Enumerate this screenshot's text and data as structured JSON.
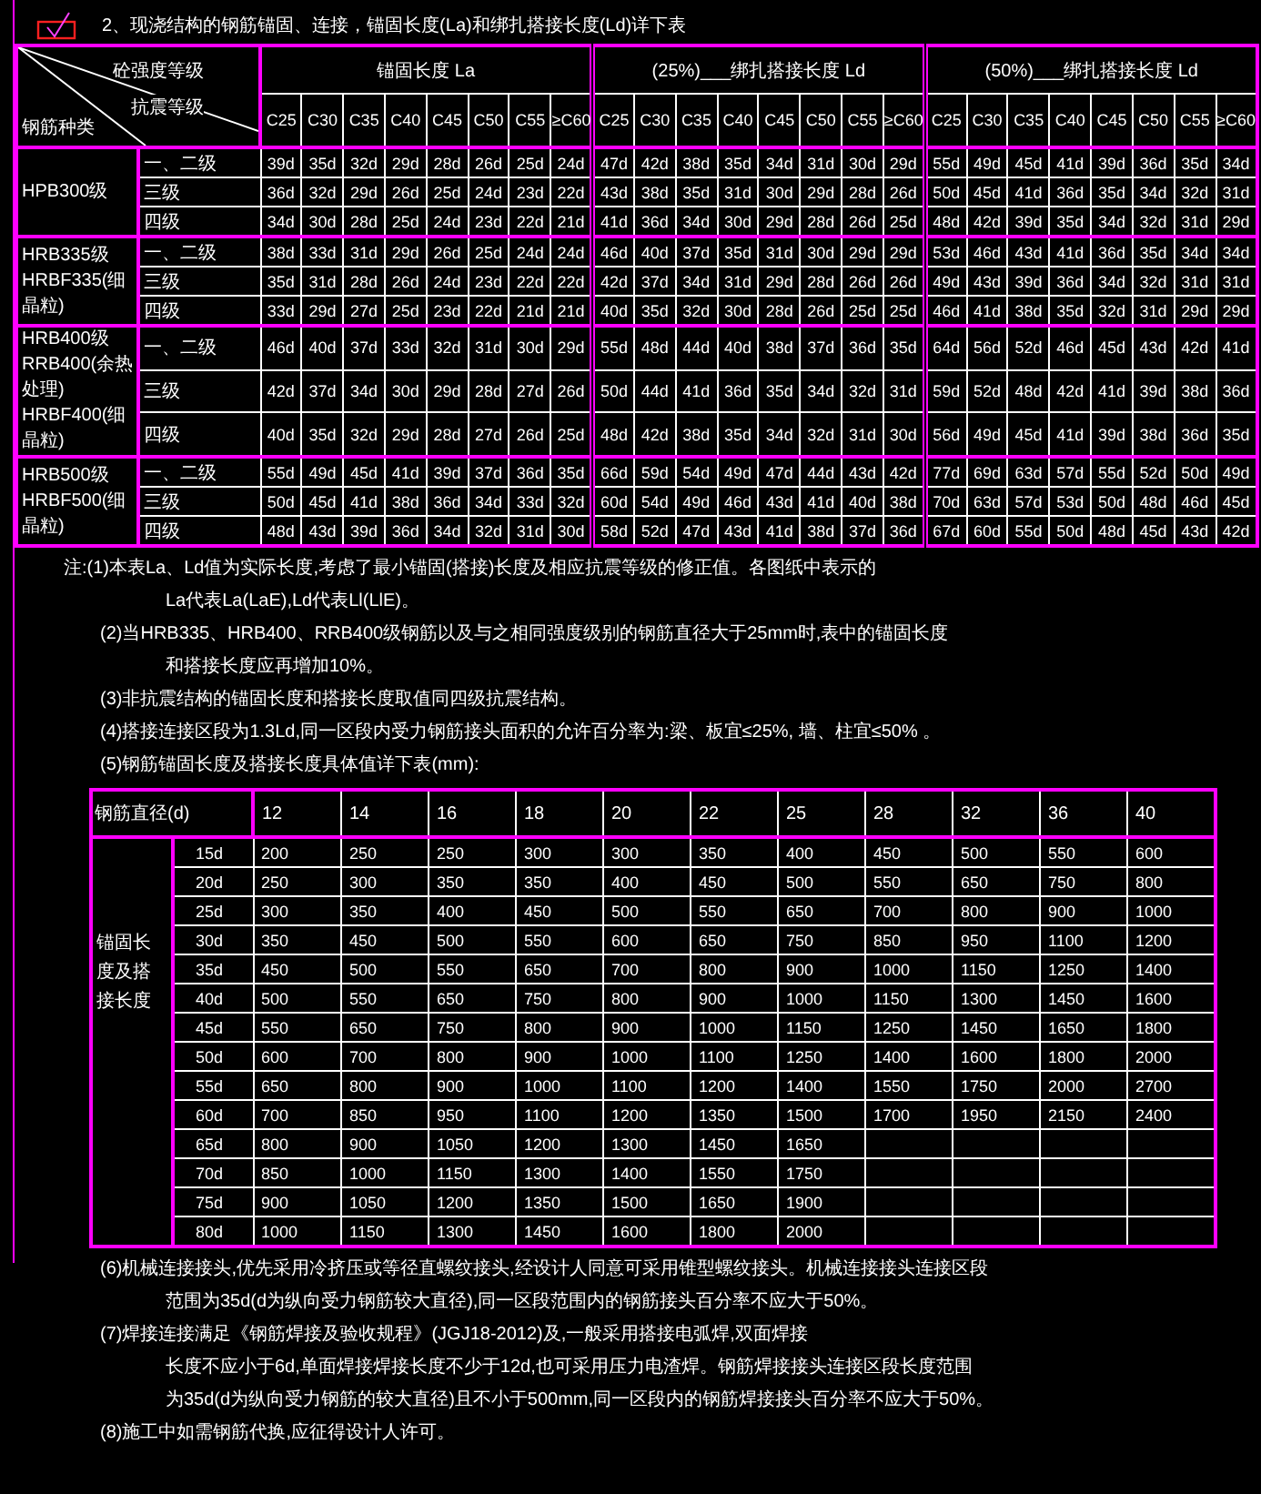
{
  "title_checkbox": {
    "checked": true
  },
  "title": "2、现浇结构的钢筋锚固、连接，锚固长度(La)和绑扎搭接长度(Ld)详下表",
  "anchor_table": {
    "corner": {
      "top": "砼强度等级",
      "middle": "抗震等级",
      "bottom": "钢筋种类"
    },
    "groups": [
      {
        "label": "锚固长度 La",
        "grades": [
          "C25",
          "C30",
          "C35",
          "C40",
          "C45",
          "C50",
          "C55",
          "≥C60"
        ]
      },
      {
        "label": "(25%)___绑扎搭接长度 Ld",
        "grades": [
          "C25",
          "C30",
          "C35",
          "C40",
          "C45",
          "C50",
          "C55",
          "≥C60"
        ]
      },
      {
        "label": "(50%)___绑扎搭接长度 Ld",
        "grades": [
          "C25",
          "C30",
          "C35",
          "C40",
          "C45",
          "C50",
          "C55",
          "≥C60"
        ]
      }
    ],
    "steel_types": [
      {
        "names": [
          "HPB300级"
        ],
        "rows": [
          {
            "level": "一、二级",
            "values": [
              "39d",
              "35d",
              "32d",
              "29d",
              "28d",
              "26d",
              "25d",
              "24d",
              "47d",
              "42d",
              "38d",
              "35d",
              "34d",
              "31d",
              "30d",
              "29d",
              "55d",
              "49d",
              "45d",
              "41d",
              "39d",
              "36d",
              "35d",
              "34d"
            ]
          },
          {
            "level": "三级",
            "values": [
              "36d",
              "32d",
              "29d",
              "26d",
              "25d",
              "24d",
              "23d",
              "22d",
              "43d",
              "38d",
              "35d",
              "31d",
              "30d",
              "29d",
              "28d",
              "26d",
              "50d",
              "45d",
              "41d",
              "36d",
              "35d",
              "34d",
              "32d",
              "31d"
            ]
          },
          {
            "level": "四级",
            "values": [
              "34d",
              "30d",
              "28d",
              "25d",
              "24d",
              "23d",
              "22d",
              "21d",
              "41d",
              "36d",
              "34d",
              "30d",
              "29d",
              "28d",
              "26d",
              "25d",
              "48d",
              "42d",
              "39d",
              "35d",
              "34d",
              "32d",
              "31d",
              "29d"
            ]
          }
        ]
      },
      {
        "names": [
          "HRB335级",
          "HRBF335(细晶粒)"
        ],
        "rows": [
          {
            "level": "一、二级",
            "values": [
              "38d",
              "33d",
              "31d",
              "29d",
              "26d",
              "25d",
              "24d",
              "24d",
              "46d",
              "40d",
              "37d",
              "35d",
              "31d",
              "30d",
              "29d",
              "29d",
              "53d",
              "46d",
              "43d",
              "41d",
              "36d",
              "35d",
              "34d",
              "34d"
            ]
          },
          {
            "level": "三级",
            "values": [
              "35d",
              "31d",
              "28d",
              "26d",
              "24d",
              "23d",
              "22d",
              "22d",
              "42d",
              "37d",
              "34d",
              "31d",
              "29d",
              "28d",
              "26d",
              "26d",
              "49d",
              "43d",
              "39d",
              "36d",
              "34d",
              "32d",
              "31d",
              "31d"
            ]
          },
          {
            "level": "四级",
            "values": [
              "33d",
              "29d",
              "27d",
              "25d",
              "23d",
              "22d",
              "21d",
              "21d",
              "40d",
              "35d",
              "32d",
              "30d",
              "28d",
              "26d",
              "25d",
              "25d",
              "46d",
              "41d",
              "38d",
              "35d",
              "32d",
              "31d",
              "29d",
              "29d"
            ]
          }
        ]
      },
      {
        "names": [
          "HRB400级",
          "RRB400(余热处理)",
          "HRBF400(细晶粒)"
        ],
        "rows": [
          {
            "level": "一、二级",
            "values": [
              "46d",
              "40d",
              "37d",
              "33d",
              "32d",
              "31d",
              "30d",
              "29d",
              "55d",
              "48d",
              "44d",
              "40d",
              "38d",
              "37d",
              "36d",
              "35d",
              "64d",
              "56d",
              "52d",
              "46d",
              "45d",
              "43d",
              "42d",
              "41d"
            ]
          },
          {
            "level": "三级",
            "values": [
              "42d",
              "37d",
              "34d",
              "30d",
              "29d",
              "28d",
              "27d",
              "26d",
              "50d",
              "44d",
              "41d",
              "36d",
              "35d",
              "34d",
              "32d",
              "31d",
              "59d",
              "52d",
              "48d",
              "42d",
              "41d",
              "39d",
              "38d",
              "36d"
            ]
          },
          {
            "level": "四级",
            "values": [
              "40d",
              "35d",
              "32d",
              "29d",
              "28d",
              "27d",
              "26d",
              "25d",
              "48d",
              "42d",
              "38d",
              "35d",
              "34d",
              "32d",
              "31d",
              "30d",
              "56d",
              "49d",
              "45d",
              "41d",
              "39d",
              "38d",
              "36d",
              "35d"
            ]
          }
        ]
      },
      {
        "names": [
          "HRB500级",
          "HRBF500(细晶粒)"
        ],
        "rows": [
          {
            "level": "一、二级",
            "values": [
              "55d",
              "49d",
              "45d",
              "41d",
              "39d",
              "37d",
              "36d",
              "35d",
              "66d",
              "59d",
              "54d",
              "49d",
              "47d",
              "44d",
              "43d",
              "42d",
              "77d",
              "69d",
              "63d",
              "57d",
              "55d",
              "52d",
              "50d",
              "49d"
            ]
          },
          {
            "level": "三级",
            "values": [
              "50d",
              "45d",
              "41d",
              "38d",
              "36d",
              "34d",
              "33d",
              "32d",
              "60d",
              "54d",
              "49d",
              "46d",
              "43d",
              "41d",
              "40d",
              "38d",
              "70d",
              "63d",
              "57d",
              "53d",
              "50d",
              "48d",
              "46d",
              "45d"
            ]
          },
          {
            "level": "四级",
            "values": [
              "48d",
              "43d",
              "39d",
              "36d",
              "34d",
              "32d",
              "31d",
              "30d",
              "58d",
              "52d",
              "47d",
              "43d",
              "41d",
              "38d",
              "37d",
              "36d",
              "67d",
              "60d",
              "55d",
              "50d",
              "48d",
              "45d",
              "43d",
              "42d"
            ]
          }
        ]
      }
    ]
  },
  "notes": [
    {
      "kind": "head",
      "text": "注:(1)本表La、Ld值为实际长度,考虑了最小锚固(搭接)长度及相应抗震等级的修正值。各图纸中表示的"
    },
    {
      "kind": "cont",
      "text": "La代表La(LaE),Ld代表Ll(LlE)。"
    },
    {
      "kind": "item",
      "text": "(2)当HRB335、HRB400、RRB400级钢筋以及与之相同强度级别的钢筋直径大于25mm时,表中的锚固长度"
    },
    {
      "kind": "cont",
      "text": "和搭接长度应再增加10%。"
    },
    {
      "kind": "item",
      "text": "(3)非抗震结构的锚固长度和搭接长度取值同四级抗震结构。"
    },
    {
      "kind": "item",
      "text": "(4)搭接连接区段为1.3Ld,同一区段内受力钢筋接头面积的允许百分率为:梁、板宜≤25%, 墙、柱宜≤50% 。"
    },
    {
      "kind": "item",
      "text": "(5)钢筋锚固长度及搭接长度具体值详下表(mm):"
    }
  ],
  "length_table": {
    "header": "钢筋直径(d)",
    "diameters": [
      "12",
      "14",
      "16",
      "18",
      "20",
      "22",
      "25",
      "28",
      "32",
      "36",
      "40"
    ],
    "side_label": "锚固长度及搭接长度",
    "rows": [
      {
        "multiple": "15d",
        "values": [
          "200",
          "250",
          "250",
          "300",
          "300",
          "350",
          "400",
          "450",
          "500",
          "550",
          "600"
        ]
      },
      {
        "multiple": "20d",
        "values": [
          "250",
          "300",
          "350",
          "350",
          "400",
          "450",
          "500",
          "550",
          "650",
          "750",
          "800"
        ]
      },
      {
        "multiple": "25d",
        "values": [
          "300",
          "350",
          "400",
          "450",
          "500",
          "550",
          "650",
          "700",
          "800",
          "900",
          "1000"
        ]
      },
      {
        "multiple": "30d",
        "values": [
          "350",
          "450",
          "500",
          "550",
          "600",
          "650",
          "750",
          "850",
          "950",
          "1100",
          "1200"
        ]
      },
      {
        "multiple": "35d",
        "values": [
          "450",
          "500",
          "550",
          "650",
          "700",
          "800",
          "900",
          "1000",
          "1150",
          "1250",
          "1400"
        ]
      },
      {
        "multiple": "40d",
        "values": [
          "500",
          "550",
          "650",
          "750",
          "800",
          "900",
          "1000",
          "1150",
          "1300",
          "1450",
          "1600"
        ]
      },
      {
        "multiple": "45d",
        "values": [
          "550",
          "650",
          "750",
          "800",
          "900",
          "1000",
          "1150",
          "1250",
          "1450",
          "1650",
          "1800"
        ]
      },
      {
        "multiple": "50d",
        "values": [
          "600",
          "700",
          "800",
          "900",
          "1000",
          "1100",
          "1250",
          "1400",
          "1600",
          "1800",
          "2000"
        ]
      },
      {
        "multiple": "55d",
        "values": [
          "650",
          "800",
          "900",
          "1000",
          "1100",
          "1200",
          "1400",
          "1550",
          "1750",
          "2000",
          "2700"
        ]
      },
      {
        "multiple": "60d",
        "values": [
          "700",
          "850",
          "950",
          "1100",
          "1200",
          "1350",
          "1500",
          "1700",
          "1950",
          "2150",
          "2400"
        ]
      },
      {
        "multiple": "65d",
        "values": [
          "800",
          "900",
          "1050",
          "1200",
          "1300",
          "1450",
          "1650"
        ]
      },
      {
        "multiple": "70d",
        "values": [
          "850",
          "1000",
          "1150",
          "1300",
          "1400",
          "1550",
          "1750"
        ]
      },
      {
        "multiple": "75d",
        "values": [
          "900",
          "1050",
          "1200",
          "1350",
          "1500",
          "1650",
          "1900"
        ]
      },
      {
        "multiple": "80d",
        "values": [
          "1000",
          "1150",
          "1300",
          "1450",
          "1600",
          "1800",
          "2000"
        ]
      }
    ]
  },
  "notes_after": [
    {
      "kind": "item",
      "text": "(6)机械连接接头,优先采用冷挤压或等径直螺纹接头,经设计人同意可采用锥型螺纹接头。机械连接接头连接区段"
    },
    {
      "kind": "cont",
      "text": "范围为35d(d为纵向受力钢筋较大直径),同一区段范围内的钢筋接头百分率不应大于50%。"
    },
    {
      "kind": "item",
      "text": "(7)焊接连接满足《钢筋焊接及验收规程》(JGJ18-2012)及,一般采用搭接电弧焊,双面焊接"
    },
    {
      "kind": "cont",
      "text": "长度不应小于6d,单面焊接焊接长度不少于12d,也可采用压力电渣焊。钢筋焊接接头连接区段长度范围"
    },
    {
      "kind": "cont",
      "text": "为35d(d为纵向受力钢筋的较大直径)且不小于500mm,同一区段内的钢筋焊接接头百分率不应大于50%。"
    },
    {
      "kind": "item",
      "text": "(8)施工中如需钢筋代换,应征得设计人许可。"
    }
  ]
}
